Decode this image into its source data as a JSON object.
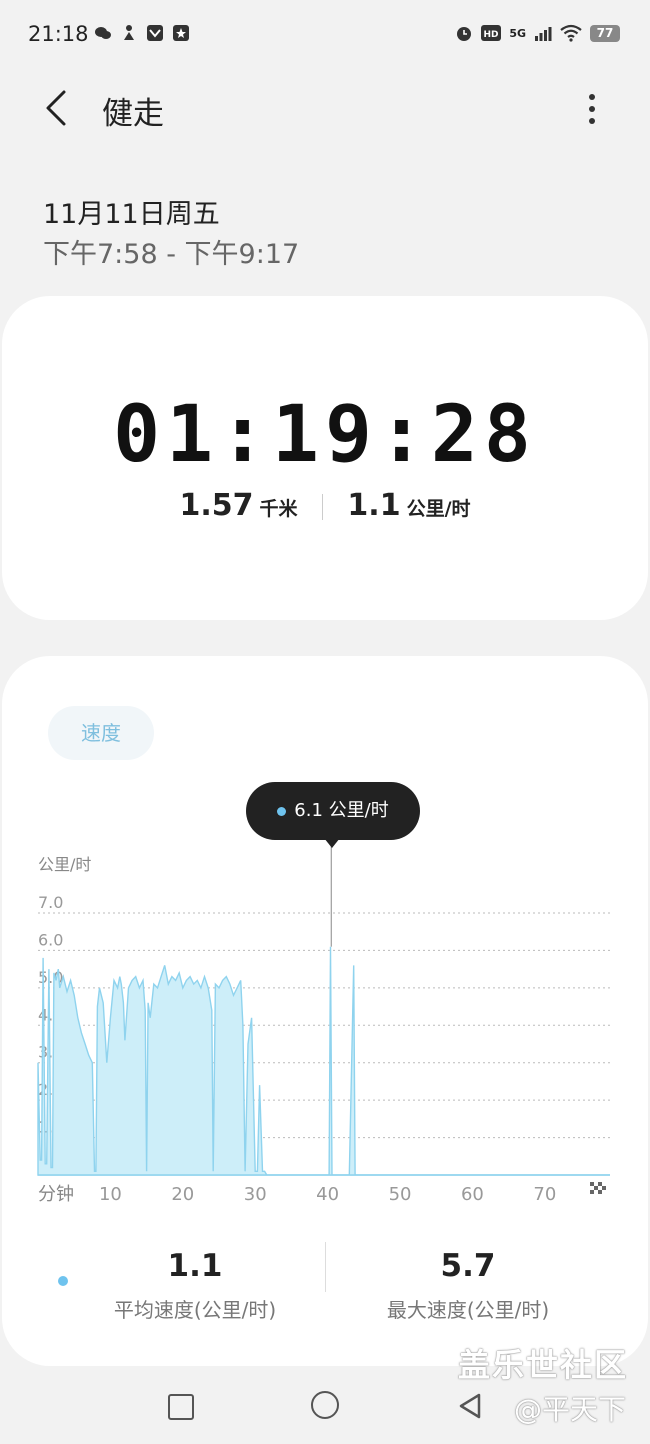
{
  "status_bar": {
    "time": "21:18",
    "network": "5G",
    "battery": "77"
  },
  "header": {
    "title": "健走"
  },
  "session": {
    "date": "11月11日周五",
    "time_range": "下午7:58 - 下午9:17"
  },
  "summary": {
    "duration": "01:19:28",
    "distance_value": "1.57",
    "distance_unit": "千米",
    "speed_value": "1.1",
    "speed_unit": "公里/时"
  },
  "chart_section": {
    "tab_label": "速度",
    "tooltip_text": "6.1 公里/时"
  },
  "chart_data": {
    "type": "area",
    "ylabel": "公里/时",
    "xlabel": "分钟",
    "ylim": [
      0,
      7.0
    ],
    "xlim": [
      0,
      79
    ],
    "yticks": [
      "1.0",
      "2.0",
      "3.0",
      "4.0",
      "5.0",
      "6.0",
      "7.0"
    ],
    "xticks": [
      "10",
      "20",
      "30",
      "40",
      "50",
      "60",
      "70"
    ],
    "grid": true,
    "color": "#8fd3ee",
    "selected_point": {
      "x": 40.5,
      "y": 6.1
    },
    "x": [
      0,
      0.3,
      0.5,
      0.7,
      1,
      1.2,
      1.5,
      1.8,
      2,
      2.2,
      2.5,
      2.8,
      3,
      3.5,
      4,
      4.5,
      5,
      5.5,
      6,
      6.5,
      7,
      7.5,
      7.8,
      8,
      8.2,
      8.5,
      9,
      9.5,
      10,
      10.5,
      11,
      11.3,
      11.5,
      11.8,
      12,
      12.5,
      13,
      13.5,
      14,
      14.5,
      14.8,
      15,
      15.2,
      15.5,
      16,
      16.5,
      17,
      17.5,
      18,
      18.5,
      19,
      19.5,
      20,
      20.5,
      21,
      21.5,
      22,
      22.5,
      23,
      23.5,
      24,
      24.2,
      24.5,
      25,
      25.5,
      26,
      26.5,
      27,
      27.5,
      28,
      28.3,
      28.6,
      29,
      29.5,
      30,
      30.3,
      30.6,
      31,
      31.3,
      31.6,
      32,
      39,
      40.2,
      40.4,
      40.6,
      40.8,
      41,
      43,
      43.6,
      43.8,
      44,
      44.2,
      44.5,
      79
    ],
    "values": [
      3.0,
      0.4,
      0.4,
      5.8,
      0.3,
      0.3,
      5.5,
      0.2,
      0.2,
      5.4,
      5.2,
      5.5,
      5.0,
      5.3,
      4.9,
      5.2,
      4.8,
      4.2,
      3.8,
      3.5,
      3.2,
      3.0,
      0.1,
      0.1,
      4.5,
      5.0,
      4.6,
      3.0,
      4.2,
      5.2,
      5.0,
      5.3,
      5.1,
      4.6,
      3.6,
      5.0,
      5.2,
      5.3,
      5.0,
      5.2,
      4.4,
      0.1,
      4.6,
      4.2,
      5.1,
      5.0,
      5.3,
      5.6,
      5.1,
      5.3,
      5.2,
      5.4,
      5.0,
      5.2,
      5.3,
      5.1,
      5.2,
      5.0,
      5.3,
      5.0,
      4.4,
      0.1,
      5.1,
      5.0,
      5.2,
      5.3,
      5.1,
      4.8,
      5.0,
      5.2,
      4.0,
      0.1,
      3.5,
      4.2,
      0.1,
      0.1,
      2.4,
      0.1,
      0.1,
      0,
      0,
      0,
      0,
      6.1,
      0,
      0,
      0,
      0,
      5.6,
      0,
      0,
      0,
      0,
      0
    ]
  },
  "footer_stats": {
    "avg_value": "1.1",
    "avg_label": "平均速度(公里/时)",
    "max_value": "5.7",
    "max_label": "最大速度(公里/时)"
  },
  "watermark": {
    "line1": "盖乐世社区",
    "line2": "@平天下"
  }
}
